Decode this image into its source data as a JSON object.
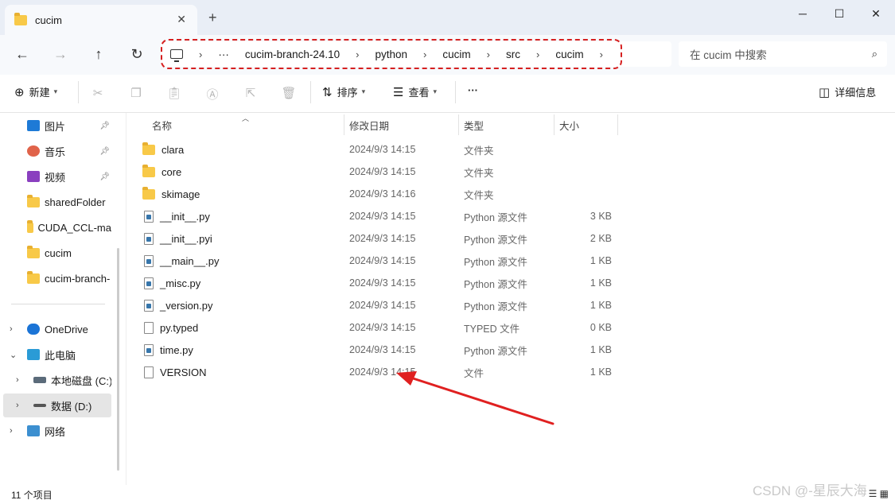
{
  "window": {
    "tab_title": "cucim",
    "tab_close": "✕",
    "new_tab": "+",
    "minimize": "─",
    "maximize": "☐",
    "close": "✕"
  },
  "nav": {
    "back": "←",
    "forward": "→",
    "up": "↑",
    "refresh": "↻",
    "breadcrumbs": [
      "···",
      "cucim-branch-24.10",
      "python",
      "cucim",
      "src",
      "cucim"
    ],
    "search_placeholder": "在 cucim 中搜索"
  },
  "toolbar": {
    "new_label": "新建",
    "sort_label": "排序",
    "view_label": "查看",
    "more_label": "···",
    "details_label": "详细信息"
  },
  "sidebar": {
    "items": [
      {
        "label": "图片",
        "icon": "pictures-icon",
        "color": "#1e7ad6",
        "pinned": true
      },
      {
        "label": "音乐",
        "icon": "music-icon",
        "color": "#e0634a",
        "pinned": true
      },
      {
        "label": "视频",
        "icon": "videos-icon",
        "color": "#8a3fbf",
        "pinned": true
      },
      {
        "label": "sharedFolder",
        "icon": "folder-icon",
        "color": "#f8c948"
      },
      {
        "label": "CUDA_CCL-ma",
        "icon": "folder-icon",
        "color": "#f8c948"
      },
      {
        "label": "cucim",
        "icon": "folder-icon",
        "color": "#f8c948"
      },
      {
        "label": "cucim-branch-",
        "icon": "folder-icon",
        "color": "#f8c948"
      }
    ],
    "tree": [
      {
        "label": "OneDrive",
        "icon": "onedrive-icon",
        "expanded": false
      },
      {
        "label": "此电脑",
        "icon": "this-pc-icon",
        "expanded": true
      },
      {
        "label": "本地磁盘 (C:)",
        "icon": "drive-c-icon",
        "expanded": false
      },
      {
        "label": "数据 (D:)",
        "icon": "drive-d-icon",
        "expanded": false,
        "selected": true
      },
      {
        "label": "网络",
        "icon": "network-icon",
        "expanded": false
      }
    ]
  },
  "columns": {
    "name": "名称",
    "date": "修改日期",
    "type": "类型",
    "size": "大小"
  },
  "files": [
    {
      "name": "clara",
      "date": "2024/9/3 14:15",
      "type": "文件夹",
      "size": "",
      "kind": "folder"
    },
    {
      "name": "core",
      "date": "2024/9/3 14:15",
      "type": "文件夹",
      "size": "",
      "kind": "folder"
    },
    {
      "name": "skimage",
      "date": "2024/9/3 14:16",
      "type": "文件夹",
      "size": "",
      "kind": "folder"
    },
    {
      "name": "__init__.py",
      "date": "2024/9/3 14:15",
      "type": "Python 源文件",
      "size": "3 KB",
      "kind": "py"
    },
    {
      "name": "__init__.pyi",
      "date": "2024/9/3 14:15",
      "type": "Python 源文件",
      "size": "2 KB",
      "kind": "py"
    },
    {
      "name": "__main__.py",
      "date": "2024/9/3 14:15",
      "type": "Python 源文件",
      "size": "1 KB",
      "kind": "py"
    },
    {
      "name": "_misc.py",
      "date": "2024/9/3 14:15",
      "type": "Python 源文件",
      "size": "1 KB",
      "kind": "py"
    },
    {
      "name": "_version.py",
      "date": "2024/9/3 14:15",
      "type": "Python 源文件",
      "size": "1 KB",
      "kind": "py"
    },
    {
      "name": "py.typed",
      "date": "2024/9/3 14:15",
      "type": "TYPED 文件",
      "size": "0 KB",
      "kind": "file"
    },
    {
      "name": "time.py",
      "date": "2024/9/3 14:15",
      "type": "Python 源文件",
      "size": "1 KB",
      "kind": "py"
    },
    {
      "name": "VERSION",
      "date": "2024/9/3 14:15",
      "type": "文件",
      "size": "1 KB",
      "kind": "file"
    }
  ],
  "status": {
    "item_count": "11 个项目",
    "watermark": "CSDN @-星辰大海"
  },
  "colors": {
    "annotation_red": "#e02020",
    "folder_yellow": "#f8c948"
  }
}
